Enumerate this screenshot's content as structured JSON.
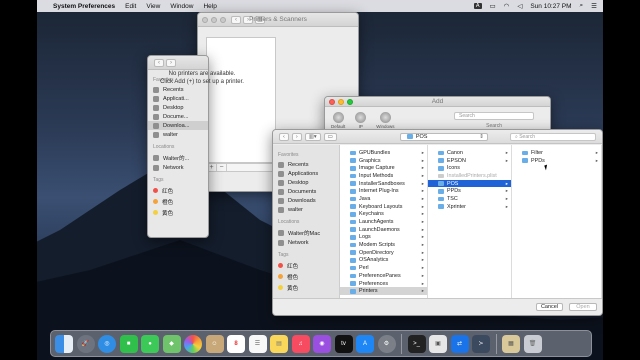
{
  "menubar": {
    "app": "System Preferences",
    "items": [
      "Edit",
      "View",
      "Window",
      "Help"
    ],
    "status": {
      "input": "A",
      "clock": "Sun 10:27 PM"
    }
  },
  "printers_window": {
    "title": "Printers & Scanners",
    "no_printers_line1": "No printers are available.",
    "no_printers_line2": "Click Add (+) to set up a printer."
  },
  "bg_sidebar": {
    "favorites_header": "Favorites",
    "favorites": [
      "Recents",
      "Applicati...",
      "Desktop",
      "Docume...",
      "Downloa...",
      "walter"
    ],
    "locations_header": "Locations",
    "locations": [
      "Walter的...",
      "Network"
    ],
    "tags_header": "Tags",
    "tags": [
      {
        "label": "红色",
        "color": "#f0524a"
      },
      {
        "label": "橙色",
        "color": "#f5a23a"
      },
      {
        "label": "黄色",
        "color": "#f4d03f"
      }
    ]
  },
  "add_window": {
    "title": "Add",
    "tools": [
      "Default",
      "IP",
      "Windows"
    ],
    "search_placeholder": "Search",
    "search_label": "Search"
  },
  "dialog": {
    "path": "POS",
    "search_placeholder": "Search",
    "sidebar": {
      "favorites_header": "Favorites",
      "favorites": [
        "Recents",
        "Applications",
        "Desktop",
        "Documents",
        "Downloads",
        "walter"
      ],
      "locations_header": "Locations",
      "locations": [
        "Walter的Mac",
        "Network"
      ],
      "tags_header": "Tags",
      "tags": [
        {
          "label": "红色",
          "color": "#f0524a"
        },
        {
          "label": "橙色",
          "color": "#f5a23a"
        },
        {
          "label": "黄色",
          "color": "#f4d03f"
        }
      ]
    },
    "column1": [
      "GPUBundles",
      "Graphics",
      "Image Capture",
      "Input Methods",
      "InstallerSandboxes",
      "Internet Plug-Ins",
      "Java",
      "Keyboard Layouts",
      "Keychains",
      "LaunchAgents",
      "LaunchDaemons",
      "Logs",
      "Modem Scripts",
      "OpenDirectory",
      "OSAnalytics",
      "Perl",
      "PreferencePanes",
      "Preferences",
      "Printers"
    ],
    "column2": [
      "Canon",
      "EPSON",
      "Icons",
      "InstalledPrinters.plist",
      "POS",
      "PPDs",
      "TSC",
      "Xprinter"
    ],
    "column3": [
      "Filter",
      "PPDs"
    ],
    "cancel": "Cancel",
    "open": "Open"
  },
  "dock": {
    "apps": [
      "Finder",
      "Launchpad",
      "Safari",
      "FaceTime",
      "Messages",
      "Maps",
      "Photos",
      "Contacts",
      "Calendar",
      "Reminders",
      "Notes",
      "Music",
      "Podcasts",
      "TV",
      "App Store",
      "System Preferences",
      "Terminal",
      "Printer Utility",
      "TeamViewer",
      "Remote Desktop",
      "Downloads",
      "Trash"
    ],
    "calendar_day": "8"
  }
}
